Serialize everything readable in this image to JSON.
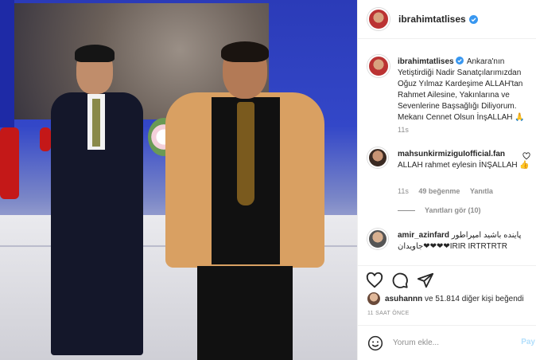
{
  "post": {
    "author": "ibrahimtatlises",
    "caption": "Ankara'nın Yetiştirdiği Nadir Sanatçılarımızdan Oğuz Yılmaz Kardeşime ALLAH'tan Rahmet Ailesine, Yakınlarına ve Sevenlerine Başsağlığı Diliyorum. Mekanı Cennet Olsun İnşALLAH 🙏",
    "caption_time": "11s",
    "likes_text_user": "asuhannn",
    "likes_text_rest": "ve 51.814 diğer kişi beğendi",
    "posted_ago": "11 SAAT ÖNCE"
  },
  "comments": [
    {
      "user": "mahsunkirmiziguIofficial.fan",
      "text": "ALLAH rahmet eylesin İNŞALLAH 👍",
      "time": "11s",
      "likes": "49 beğenme",
      "reply": "Yanıtla",
      "view_replies": "Yanıtları gör (10)"
    },
    {
      "user": "amir_azinfard",
      "text": "پاینده باشید امپراطور جاویدان❤❤❤❤IRIR IRTRTRTR"
    }
  ],
  "add_comment": {
    "placeholder": "Yorum ekle...",
    "post_label": "Pay"
  },
  "icons": {
    "like": "heart-icon",
    "comment": "comment-icon",
    "share": "share-icon",
    "verified": "verified-badge-icon"
  },
  "colors": {
    "verified": "#3897f0",
    "muted": "#8e8e8e",
    "post_button": "#b2dffc"
  }
}
